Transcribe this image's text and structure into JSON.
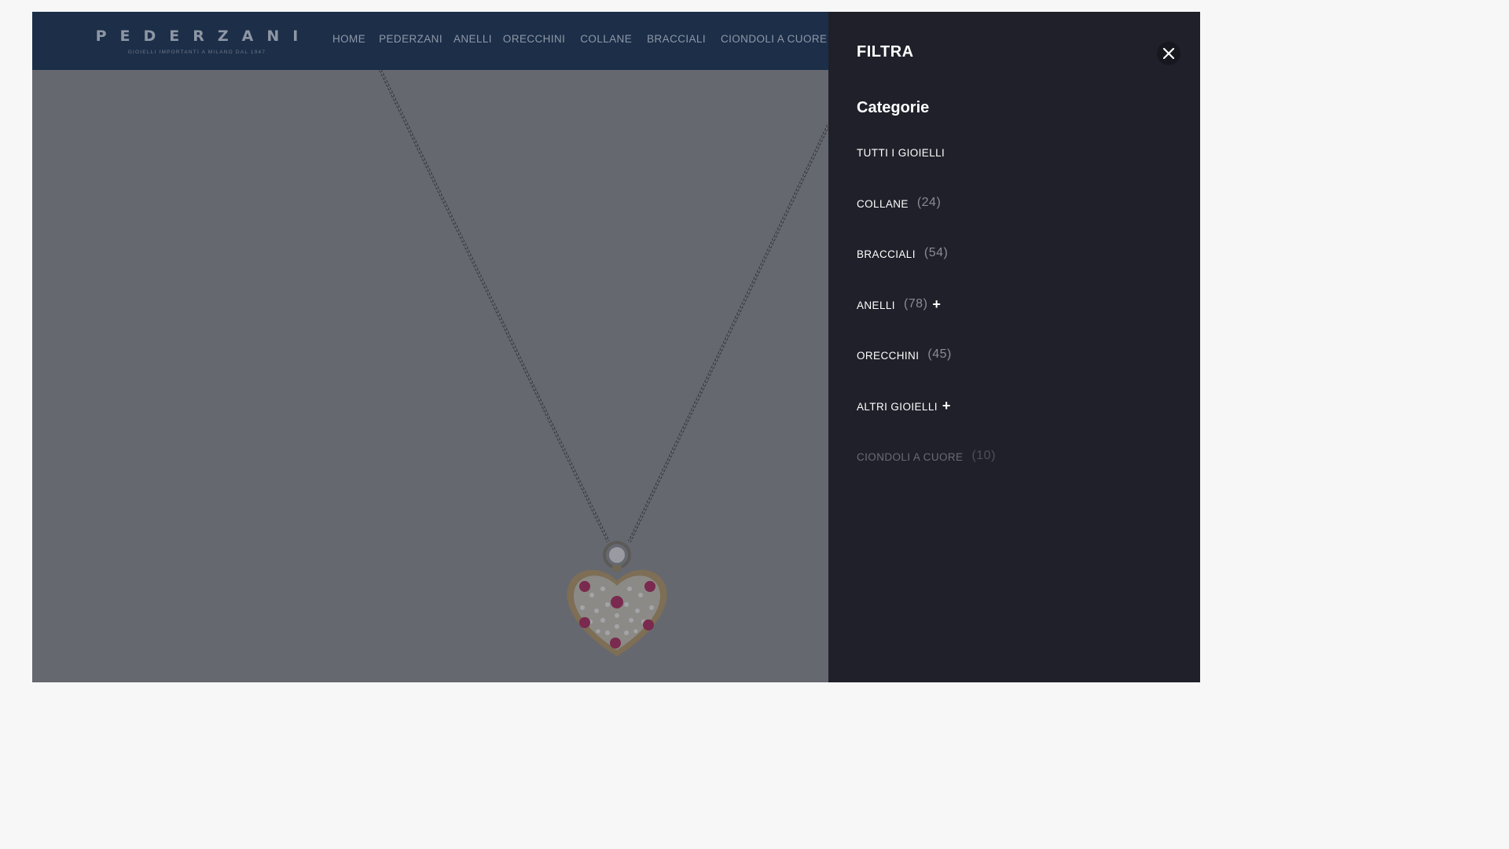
{
  "header": {
    "logo": {
      "name": "PEDERZANI",
      "tagline": "GIOIELLI IMPORTANTI A MILANO DAL 1947"
    },
    "nav": [
      {
        "label": "HOME",
        "name": "nav-home"
      },
      {
        "label": "PEDERZANI",
        "name": "nav-pederzani"
      },
      {
        "label": "ANELLI",
        "name": "nav-anelli"
      },
      {
        "label": "ORECCHINI",
        "name": "nav-orecchini"
      },
      {
        "label": "COLLANE",
        "name": "nav-collane"
      },
      {
        "label": "BRACCIALI",
        "name": "nav-bracciali"
      },
      {
        "label": "CIONDOLI A CUORE",
        "name": "nav-ciondoli"
      }
    ]
  },
  "filter_panel": {
    "title": "FILTRA",
    "close_icon": "close-icon",
    "section_title": "Categorie",
    "categories": [
      {
        "label": "TUTTI I GIOIELLI",
        "count": "",
        "expandable": false,
        "disabled": false
      },
      {
        "label": "COLLANE",
        "count": "(24)",
        "expandable": false,
        "disabled": false
      },
      {
        "label": "BRACCIALI",
        "count": "(54)",
        "expandable": false,
        "disabled": false
      },
      {
        "label": "ANELLI",
        "count": "(78)",
        "expandable": true,
        "disabled": false
      },
      {
        "label": "ORECCHINI",
        "count": "(45)",
        "expandable": false,
        "disabled": false
      },
      {
        "label": "ALTRI GIOIELLI",
        "count": "",
        "expandable": true,
        "disabled": false
      },
      {
        "label": "CIONDOLI A CUORE",
        "count": "(10)",
        "expandable": false,
        "disabled": true
      }
    ]
  },
  "colors": {
    "header_bg": "#1c2e48",
    "overlay_bg": "#666870",
    "panel_bg": "#20202a",
    "ruby": "#b01a62",
    "gold": "#b79a5c"
  }
}
